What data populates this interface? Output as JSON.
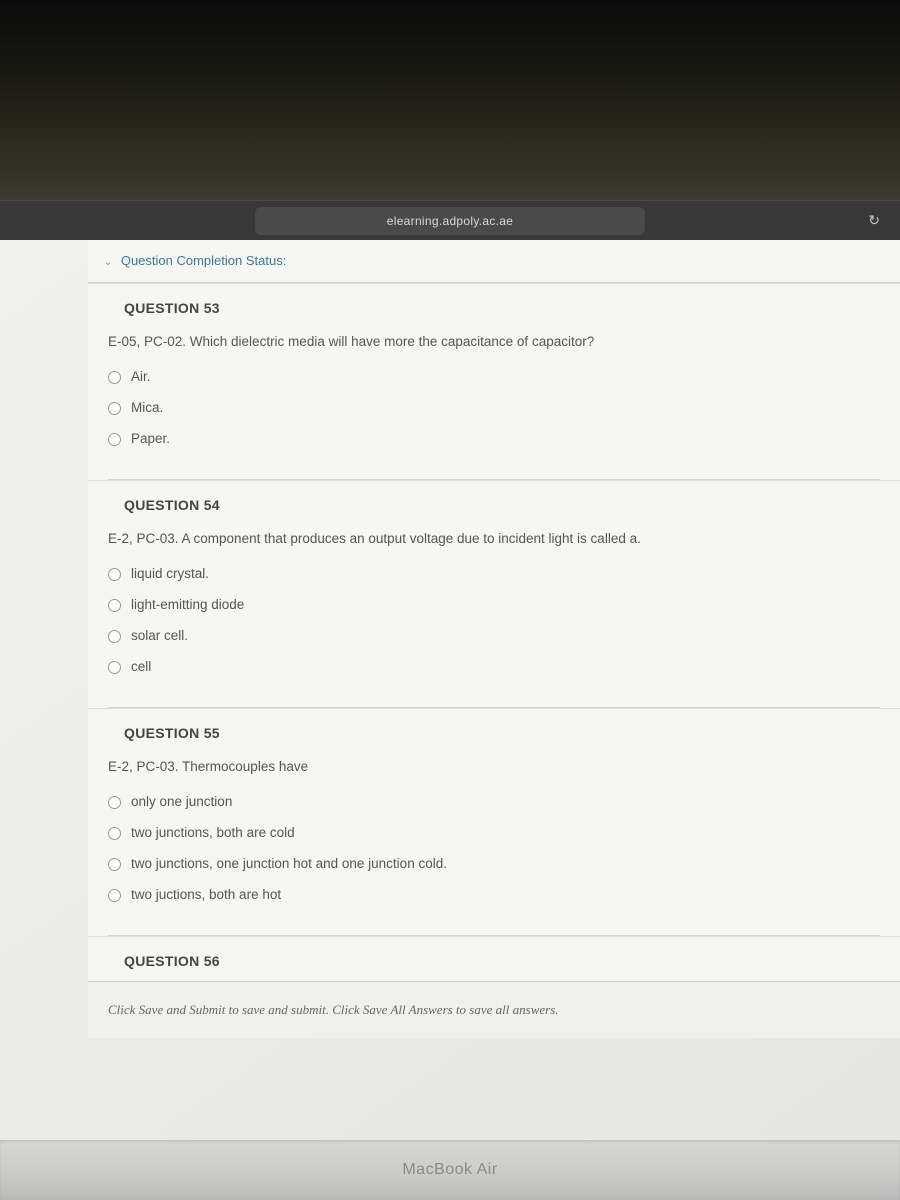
{
  "browser": {
    "url": "elearning.adpoly.ac.ae"
  },
  "status": {
    "label": "Question Completion Status:"
  },
  "questions": [
    {
      "header": "QUESTION 53",
      "text": "E-05, PC-02. Which  dielectric media will have more  the capacitance of capacitor?",
      "options": [
        "Air.",
        "Mica.",
        "Paper."
      ]
    },
    {
      "header": "QUESTION 54",
      "text": "E-2, PC-03. A component that produces an output voltage due to incident light is called a.",
      "options": [
        "liquid crystal.",
        "light-emitting diode",
        "solar cell.",
        "cell"
      ]
    },
    {
      "header": "QUESTION 55",
      "text": "E-2, PC-03. Thermocouples have",
      "options": [
        "only one junction",
        "two junctions, both are cold",
        "two junctions, one junction hot and one junction cold.",
        "two juctions, both are hot"
      ]
    },
    {
      "header": "QUESTION 56",
      "text": "",
      "options": []
    }
  ],
  "submit": {
    "hint": "Click Save and Submit to save and submit. Click Save All Answers to save all answers."
  },
  "device": {
    "label": "MacBook Air"
  }
}
